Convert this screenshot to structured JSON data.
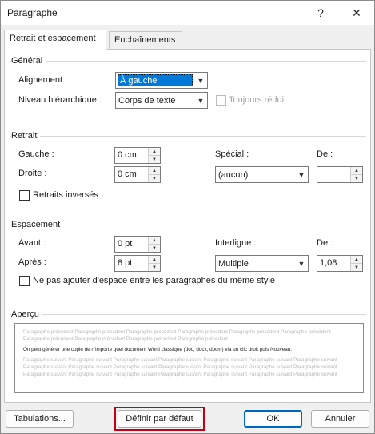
{
  "window": {
    "title": "Paragraphe",
    "help_glyph": "?",
    "close_glyph": "✕"
  },
  "tabs": [
    {
      "label": "Retrait et espacement",
      "active": true
    },
    {
      "label": "Enchaînements",
      "active": false
    }
  ],
  "general": {
    "section": "Général",
    "alignment_label": "Alignement :",
    "alignment_value": "À gauche",
    "outline_label": "Niveau hiérarchique :",
    "outline_value": "Corps de texte",
    "collapsed_label": "Toujours réduit"
  },
  "indent": {
    "section": "Retrait",
    "left_label": "Gauche :",
    "left_value": "0 cm",
    "right_label": "Droite :",
    "right_value": "0 cm",
    "special_label": "Spécial :",
    "special_value": "(aucun)",
    "by_label": "De :",
    "by_value": "",
    "mirror_label": "Retraits inversés"
  },
  "spacing": {
    "section": "Espacement",
    "before_label": "Avant :",
    "before_value": "0 pt",
    "after_label": "Après :",
    "after_value": "8 pt",
    "line_label": "Interligne :",
    "line_value": "Multiple",
    "at_label": "De :",
    "at_value": "1,08",
    "no_space_label": "Ne pas ajouter d'espace entre les paragraphes du même style"
  },
  "preview": {
    "section": "Aperçu",
    "prev_lines": [
      "Paragraphe précédent Paragraphe précédent Paragraphe précédent Paragraphe précédent Paragraphe précédent Paragraphe précédent",
      "Paragraphe précédent Paragraphe précédent Paragraphe précédent Paragraphe précédent"
    ],
    "current_text": "On peut générer une copie de n'importe quel document Word classique (doc, docx, docm) via un clic droit puis Nouveau.",
    "next_lines": [
      "Paragraphe suivant Paragraphe suivant Paragraphe suivant Paragraphe suivant Paragraphe suivant Paragraphe suivant Paragraphe suivant",
      "Paragraphe suivant Paragraphe suivant Paragraphe suivant Paragraphe suivant Paragraphe suivant Paragraphe suivant Paragraphe suivant",
      "Paragraphe suivant Paragraphe suivant Paragraphe suivant Paragraphe suivant Paragraphe suivant Paragraphe suivant Paragraphe suivant"
    ]
  },
  "buttons": {
    "tabs": "Tabulations...",
    "set_default": "Définir par défaut",
    "ok": "OK",
    "cancel": "Annuler"
  },
  "colors": {
    "accent": "#0078d7",
    "highlight": "#c40014"
  }
}
